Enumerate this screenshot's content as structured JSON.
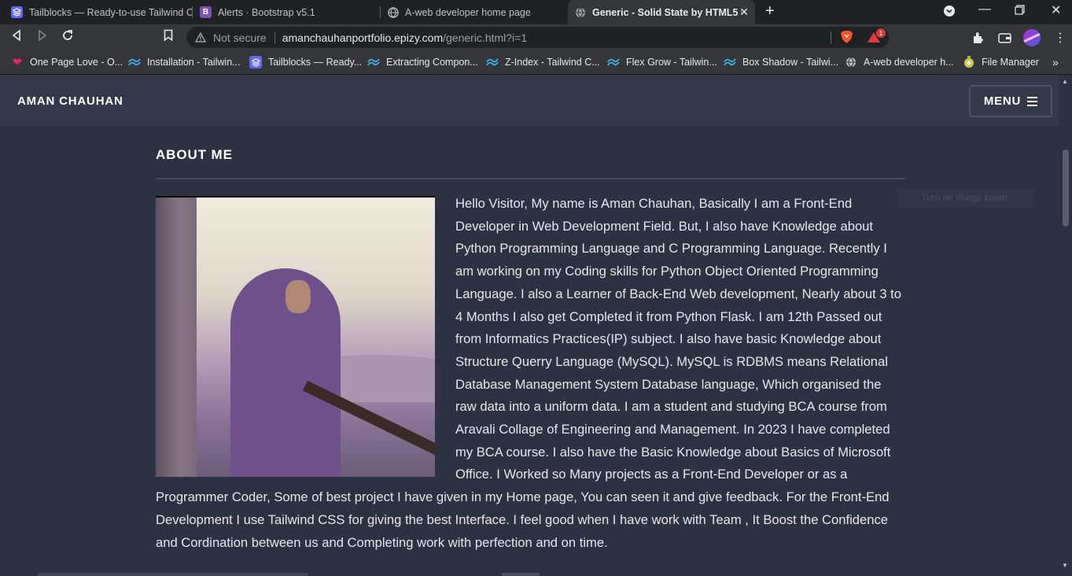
{
  "browser": {
    "tabs": [
      {
        "title": "Tailblocks — Ready-to-use Tailwind CSS",
        "icon": "tailblocks-icon",
        "color": "#6366f1"
      },
      {
        "title": "Alerts · Bootstrap v5.1",
        "icon": "bootstrap-icon",
        "color": "#7952b3",
        "glyph": "B"
      },
      {
        "title": "A-web developer home page",
        "icon": "globe-icon"
      },
      {
        "title": "Generic - Solid State by HTML5 UP",
        "icon": "globe-icon",
        "active": true
      }
    ],
    "new_tab": "+",
    "address": {
      "security": "Not secure",
      "host": "amanchauhanportfolio.epizy.com",
      "path": "/generic.html?i=1"
    },
    "brave_badge": "1",
    "bookmarks": [
      {
        "label": "One Page Love - O...",
        "icon": "heart-icon"
      },
      {
        "label": "Installation - Tailwin...",
        "icon": "tailwind-icon"
      },
      {
        "label": "Tailblocks — Ready...",
        "icon": "tailblocks-icon"
      },
      {
        "label": "Extracting Compon...",
        "icon": "tailwind-icon"
      },
      {
        "label": "Z-Index - Tailwind C...",
        "icon": "tailwind-icon"
      },
      {
        "label": "Flex Grow - Tailwin...",
        "icon": "tailwind-icon"
      },
      {
        "label": "Box Shadow - Tailwi...",
        "icon": "tailwind-icon"
      },
      {
        "label": "A-web developer h...",
        "icon": "globe-icon"
      },
      {
        "label": "File Manager",
        "icon": "file-manager-icon"
      }
    ],
    "more_bookmarks": "»"
  },
  "site": {
    "brand": "AMAN CHAUHAN",
    "menu_label": "MENU",
    "section_title": "ABOUT ME",
    "tooltip": "Turn on image zoom",
    "about_text": "Hello Visitor, My name is Aman Chauhan, Basically I am a Front-End Developer in Web Development Field. But, I also have Knowledge about Python Programming Language and C Programming Language. Recently I am working on my Coding skills for Python Object Oriented Programming Language. I also a Learner of Back-End Web development, Nearly about 3 to 4 Months I also get Completed it from Python Flask. I am 12th Passed out from Informatics Practices(IP) subject. I also have basic Knowledge about Structure Querry Language (MySQL). MySQL is RDBMS means Relational Database Management System Database language, Which organised the raw data into a uniform data. I am a student and studying BCA course from Aravali Collage of Engineering and Management. In 2023 I have completed my BCA course. I also have the Basic Knowledge about Basics of Microsoft Office. I Worked so Many projects as a Front-End Developer or as a Programmer Coder, Some of best project I have given in my Home page, You can seen it and give feedback. For the Front-End Development I use Tailwind CSS for giving the best Interface. I feel good when I have work with Team , It Boost the Confidence and Cordination between us and Completing work with perfection and on time."
  }
}
